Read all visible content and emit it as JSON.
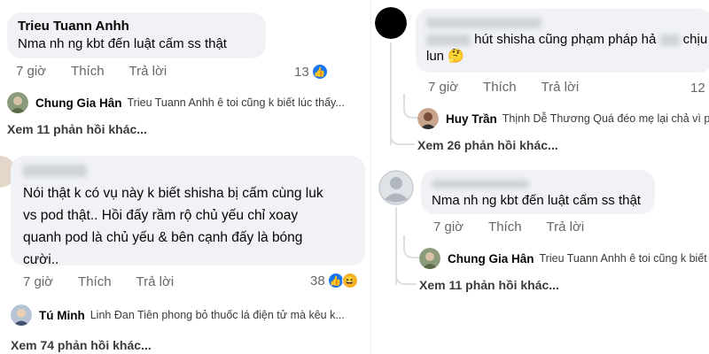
{
  "left": {
    "comment1": {
      "author": "Trieu Tuann Anhh",
      "text": "Nma nh ng kbt đến luật cấm ss thật",
      "time": "7 giờ",
      "like_label": "Thích",
      "reply_label": "Trả lời",
      "reactions": "13"
    },
    "reply1": {
      "author": "Chung Gia Hân",
      "text": "Trieu Tuann Anhh ê toi cũng k biết lúc thấy..."
    },
    "more1": "Xem 11 phản hồi khác...",
    "comment2": {
      "text_lines": [
        "Nói thật k có vụ này k biết shisha bị cấm cùng luk",
        "vs pod thật.. Hồi đấy rầm rộ chủ yếu chỉ xoay",
        "quanh pod là chủ yếu & bên cạnh đấy là bóng",
        "cười.."
      ],
      "time": "7 giờ",
      "like_label": "Thích",
      "reply_label": "Trả lời",
      "reactions": "38"
    },
    "reply2": {
      "author": "Tú Minh",
      "text": "Linh Đan Tiên phong bỏ thuốc lá điện tử mà kêu k..."
    },
    "more2": "Xem 74 phản hồi khác..."
  },
  "right": {
    "comment1": {
      "text_part": "hút shisha cũng phạm pháp hả",
      "text_line2": "lun 🤔",
      "time_suffix": "chịu",
      "time": "7 giờ",
      "like_label": "Thích",
      "reply_label": "Trả lời",
      "reactions": "12"
    },
    "reply1": {
      "author": "Huy Trần",
      "text": "Thịnh Dễ Thương Quá đéo mẹ lại chả vì phạm"
    },
    "more1": "Xem 26 phản hồi khác...",
    "comment2": {
      "text": "Nma nh ng kbt đến luật cấm ss thật",
      "time": "7 giờ",
      "like_label": "Thích",
      "reply_label": "Trả lời"
    },
    "reply2": {
      "author": "Chung Gia Hân",
      "text": "Trieu Tuann Anhh ê toi cũng k biết lúc"
    },
    "more2": "Xem 11 phản hồi khác..."
  },
  "colors": {
    "bubble": "#f0f2f5",
    "meta": "#65676b",
    "like": "#1877f2",
    "haha": "#f7b125"
  }
}
